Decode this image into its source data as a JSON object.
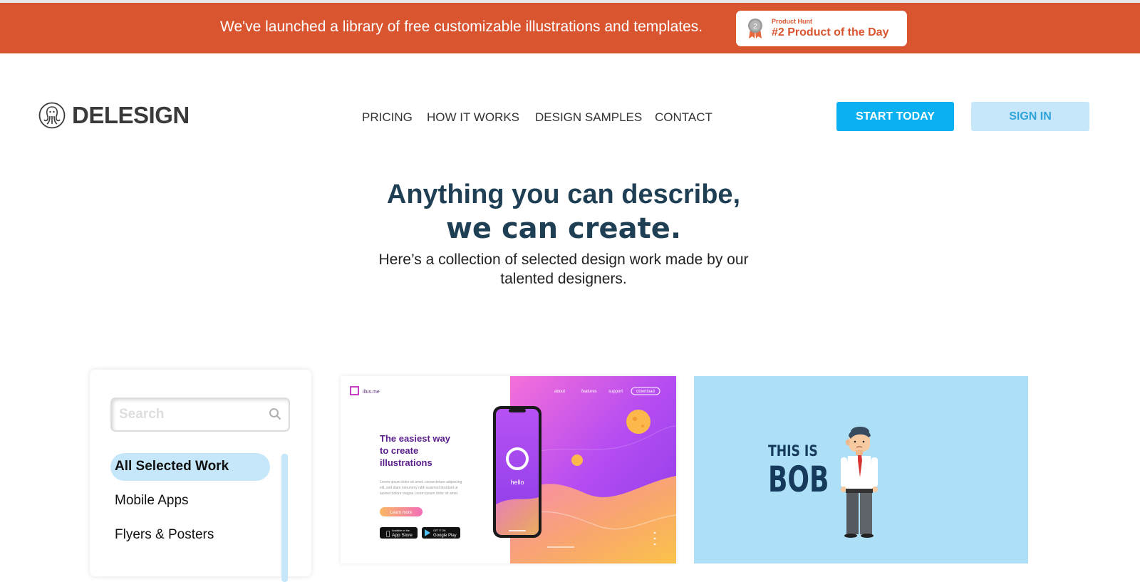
{
  "banner": {
    "text": "We've launched a library of free customizable illustrations and templates.",
    "badge_small": "Product Hunt",
    "badge_big": "#2 Product of the Day",
    "badge_rank": "2"
  },
  "header": {
    "logo_text": "DELESIGN",
    "nav": [
      "PRICING",
      "HOW IT WORKS",
      "DESIGN SAMPLES",
      "CONTACT"
    ],
    "start_label": "START TODAY",
    "signin_label": "SIGN IN"
  },
  "hero": {
    "line1": "Anything you can describe,",
    "line2": "we can create.",
    "sub": "Here’s a collection of selected design work made by our talented designers."
  },
  "filter": {
    "search_placeholder": "Search",
    "categories": [
      "All Selected Work",
      "Mobile Apps",
      "Flyers & Posters"
    ]
  },
  "card1": {
    "brand": "illus.me",
    "nav": [
      "about",
      "features",
      "support",
      "download"
    ],
    "headline": [
      "The easiest way",
      "to create",
      "illustrations"
    ],
    "body": [
      "Lorem ipsum dolor sit amet, consectetuer adipiscing",
      "elit, sed diam nonummy nibh euismod tincidunt ut",
      "laoreet dolore magna Lorem ipsum dolor sit amet."
    ],
    "cta": "Learn more",
    "store_apple_small": "Available on the",
    "store_apple": "App Store",
    "store_google_small": "GET IT ON",
    "store_google": "Google Play",
    "phone_text": "hello"
  },
  "card2": {
    "line1": "THIS IS",
    "line2": "BOB"
  },
  "colors": {
    "banner": "#d95530",
    "accent": "#0ab0ef",
    "accent_light": "#c6e7f9",
    "heading": "#1f3f55"
  }
}
